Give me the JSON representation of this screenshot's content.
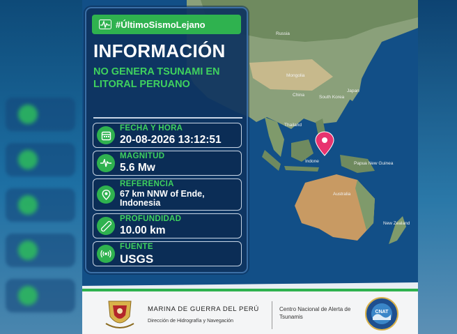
{
  "hashtag": "#ÚltimoSismoLejano",
  "title": "INFORMACIÓN",
  "subtitle": "NO GENERA TSUNAMI EN LITORAL PERUANO",
  "fields": [
    {
      "label": "FECHA Y HORA",
      "value": "20-08-2026 13:12:51",
      "icon": "calendar-icon"
    },
    {
      "label": "MAGNITUD",
      "value": "5.6 Mw",
      "icon": "waveform-icon"
    },
    {
      "label": "REFERENCIA",
      "value": "67 km NNW of Ende, Indonesia",
      "icon": "location-pin-icon"
    },
    {
      "label": "PROFUNDIDAD",
      "value": "10.00 km",
      "icon": "ruler-icon"
    },
    {
      "label": "FUENTE",
      "value": "USGS",
      "icon": "broadcast-icon"
    }
  ],
  "map_labels": {
    "russia": "Russia",
    "mongolia": "Mongolia",
    "china": "China",
    "south_korea": "South Korea",
    "japan": "Japan",
    "thailand": "Thailand",
    "indonesia": "Indone",
    "papua": "Papua New Guinea",
    "australia": "Australia",
    "new_zealand": "New Zealand"
  },
  "footer": {
    "org": "MARINA DE GUERRA DEL PERÚ",
    "department": "Dirección de Hidrografía y Navegación",
    "center": "Centro Nacional de Alerta de Tsunamis",
    "badge": "CNAT"
  },
  "colors": {
    "accent_green": "#2fb24f",
    "panel_blue": "#0e345f",
    "ocean": "#0f4f86",
    "marker": "#e8336f"
  }
}
